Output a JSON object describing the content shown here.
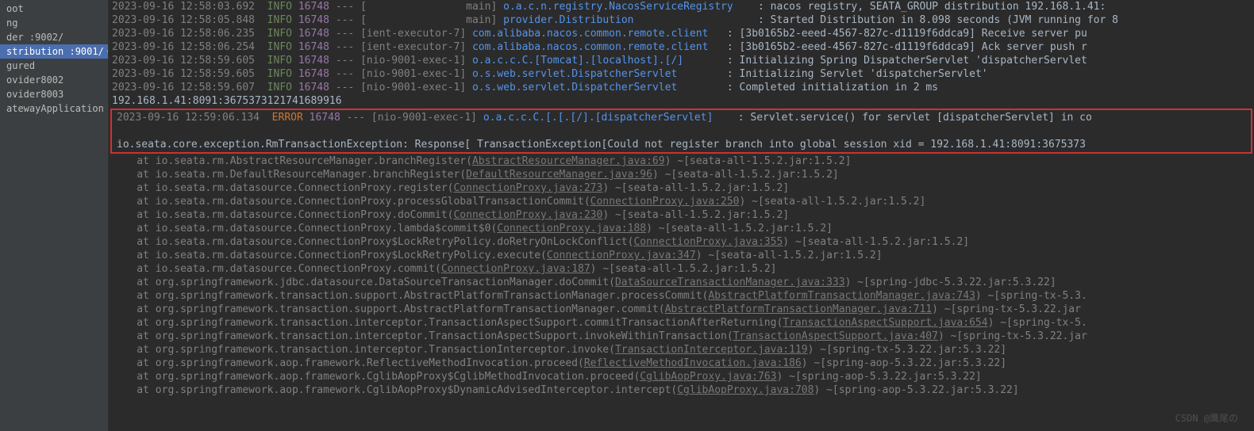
{
  "sidebar": {
    "items": [
      {
        "label": "oot"
      },
      {
        "label": "ng"
      },
      {
        "label": "der :9002/"
      },
      {
        "label": "stribution :9001/"
      },
      {
        "label": "gured"
      },
      {
        "label": "ovider8002"
      },
      {
        "label": "ovider8003"
      },
      {
        "label": "atewayApplication"
      }
    ],
    "edit_glyph": "✎"
  },
  "logs": [
    {
      "ts": "2023-09-16 12:58:03.692",
      "lvl": "INFO",
      "pid": "16748",
      "thr": "[                main]",
      "lg": "o.a.c.n.registry.NacosServiceRegistry   ",
      "msg": ": nacos registry, SEATA_GROUP distribution 192.168.1.41:"
    },
    {
      "ts": "2023-09-16 12:58:05.848",
      "lvl": "INFO",
      "pid": "16748",
      "thr": "[                main]",
      "lg": "provider.Distribution                   ",
      "msg": ": Started Distribution in 8.098 seconds (JVM running for 8"
    },
    {
      "ts": "2023-09-16 12:58:06.235",
      "lvl": "INFO",
      "pid": "16748",
      "thr": "[ient-executor-7]",
      "lg": "com.alibaba.nacos.common.remote.client  ",
      "msg": ": [3b0165b2-eeed-4567-827c-d1119f6ddca9] Receive server pu"
    },
    {
      "ts": "2023-09-16 12:58:06.254",
      "lvl": "INFO",
      "pid": "16748",
      "thr": "[ient-executor-7]",
      "lg": "com.alibaba.nacos.common.remote.client  ",
      "msg": ": [3b0165b2-eeed-4567-827c-d1119f6ddca9] Ack server push r"
    },
    {
      "ts": "2023-09-16 12:58:59.605",
      "lvl": "INFO",
      "pid": "16748",
      "thr": "[nio-9001-exec-1]",
      "lg": "o.a.c.c.C.[Tomcat].[localhost].[/]      ",
      "msg": ": Initializing Spring DispatcherServlet 'dispatcherServlet"
    },
    {
      "ts": "2023-09-16 12:58:59.605",
      "lvl": "INFO",
      "pid": "16748",
      "thr": "[nio-9001-exec-1]",
      "lg": "o.s.web.servlet.DispatcherServlet       ",
      "msg": ": Initializing Servlet 'dispatcherServlet'"
    },
    {
      "ts": "2023-09-16 12:58:59.607",
      "lvl": "INFO",
      "pid": "16748",
      "thr": "[nio-9001-exec-1]",
      "lg": "o.s.web.servlet.DispatcherServlet       ",
      "msg": ": Completed initialization in 2 ms"
    }
  ],
  "plain_line": "192.168.1.41:8091:3675373121741689916",
  "error": {
    "ts": "2023-09-16 12:59:06.134",
    "lvl": "ERROR",
    "pid": "16748",
    "thr": "[nio-9001-exec-1]",
    "lg": "o.a.c.c.C.[.[.[/].[dispatcherServlet]   ",
    "msg": ": Servlet.service() for servlet [dispatcherServlet] in co",
    "exception": "io.seata.core.exception.RmTransactionException: Response[ TransactionException[Could not register branch into global session xid = 192.168.1.41:8091:3675373"
  },
  "stack": [
    {
      "pre": "    at io.seata.rm.AbstractResourceManager.branchRegister(",
      "link": "AbstractResourceManager.java:69",
      "post": ") ~[seata-all-1.5.2.jar:1.5.2]"
    },
    {
      "pre": "    at io.seata.rm.DefaultResourceManager.branchRegister(",
      "link": "DefaultResourceManager.java:96",
      "post": ") ~[seata-all-1.5.2.jar:1.5.2]"
    },
    {
      "pre": "    at io.seata.rm.datasource.ConnectionProxy.register(",
      "link": "ConnectionProxy.java:273",
      "post": ") ~[seata-all-1.5.2.jar:1.5.2]"
    },
    {
      "pre": "    at io.seata.rm.datasource.ConnectionProxy.processGlobalTransactionCommit(",
      "link": "ConnectionProxy.java:250",
      "post": ") ~[seata-all-1.5.2.jar:1.5.2]"
    },
    {
      "pre": "    at io.seata.rm.datasource.ConnectionProxy.doCommit(",
      "link": "ConnectionProxy.java:230",
      "post": ") ~[seata-all-1.5.2.jar:1.5.2]"
    },
    {
      "pre": "    at io.seata.rm.datasource.ConnectionProxy.lambda$commit$0(",
      "link": "ConnectionProxy.java:188",
      "post": ") ~[seata-all-1.5.2.jar:1.5.2]"
    },
    {
      "pre": "    at io.seata.rm.datasource.ConnectionProxy$LockRetryPolicy.doRetryOnLockConflict(",
      "link": "ConnectionProxy.java:355",
      "post": ") ~[seata-all-1.5.2.jar:1.5.2]"
    },
    {
      "pre": "    at io.seata.rm.datasource.ConnectionProxy$LockRetryPolicy.execute(",
      "link": "ConnectionProxy.java:347",
      "post": ") ~[seata-all-1.5.2.jar:1.5.2]"
    },
    {
      "pre": "    at io.seata.rm.datasource.ConnectionProxy.commit(",
      "link": "ConnectionProxy.java:187",
      "post": ") ~[seata-all-1.5.2.jar:1.5.2]"
    },
    {
      "pre": "    at org.springframework.jdbc.datasource.DataSourceTransactionManager.doCommit(",
      "link": "DataSourceTransactionManager.java:333",
      "post": ") ~[spring-jdbc-5.3.22.jar:5.3.22]"
    },
    {
      "pre": "    at org.springframework.transaction.support.AbstractPlatformTransactionManager.processCommit(",
      "link": "AbstractPlatformTransactionManager.java:743",
      "post": ") ~[spring-tx-5.3."
    },
    {
      "pre": "    at org.springframework.transaction.support.AbstractPlatformTransactionManager.commit(",
      "link": "AbstractPlatformTransactionManager.java:711",
      "post": ") ~[spring-tx-5.3.22.jar"
    },
    {
      "pre": "    at org.springframework.transaction.interceptor.TransactionAspectSupport.commitTransactionAfterReturning(",
      "link": "TransactionAspectSupport.java:654",
      "post": ") ~[spring-tx-5."
    },
    {
      "pre": "    at org.springframework.transaction.interceptor.TransactionAspectSupport.invokeWithinTransaction(",
      "link": "TransactionAspectSupport.java:407",
      "post": ") ~[spring-tx-5.3.22.jar"
    },
    {
      "pre": "    at org.springframework.transaction.interceptor.TransactionInterceptor.invoke(",
      "link": "TransactionInterceptor.java:119",
      "post": ") ~[spring-tx-5.3.22.jar:5.3.22]"
    },
    {
      "pre": "    at org.springframework.aop.framework.ReflectiveMethodInvocation.proceed(",
      "link": "ReflectiveMethodInvocation.java:186",
      "post": ") ~[spring-aop-5.3.22.jar:5.3.22]"
    },
    {
      "pre": "    at org.springframework.aop.framework.CglibAopProxy$CglibMethodInvocation.proceed(",
      "link": "CglibAopProxy.java:763",
      "post": ") ~[spring-aop-5.3.22.jar:5.3.22]"
    },
    {
      "pre": "    at org.springframework.aop.framework.CglibAopProxy$DynamicAdvisedInterceptor.intercept(",
      "link": "CglibAopProxy.java:708",
      "post": ") ~[spring-aop-5.3.22.jar:5.3.22]"
    }
  ],
  "watermark": "CSDN @鹰尾の"
}
